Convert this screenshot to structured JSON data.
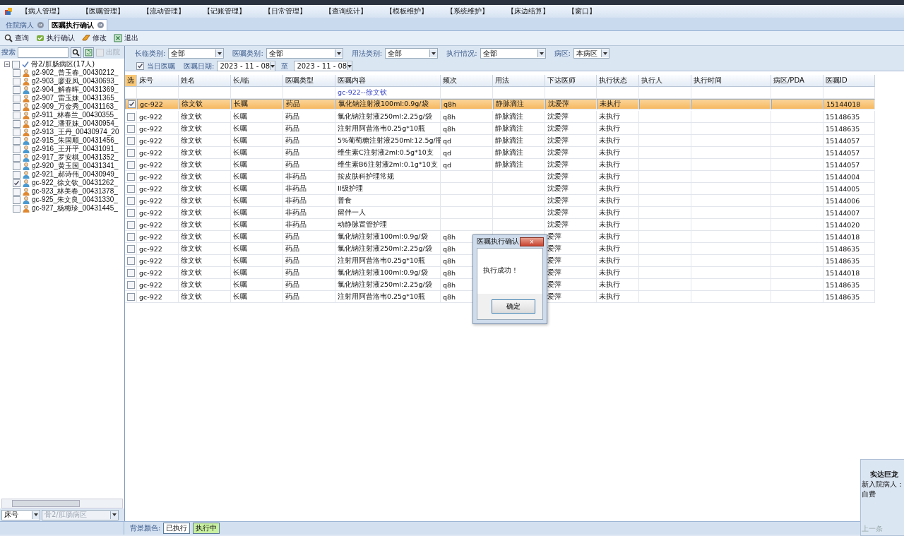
{
  "menu": [
    "【病人管理】",
    "【医嘱管理】",
    "【流动管理】",
    "【记账管理】",
    "【日常管理】",
    "【查询统计】",
    "【模板维护】",
    "【系统维护】",
    "【床边结算】",
    "【窗口】"
  ],
  "tabs": [
    {
      "label": "住院病人",
      "selected": false
    },
    {
      "label": "医嘱执行确认",
      "selected": true
    }
  ],
  "toolbar": [
    {
      "label": "查询",
      "kind": "search"
    },
    {
      "label": "执行确认",
      "kind": "confirm"
    },
    {
      "label": "修改",
      "kind": "edit"
    },
    {
      "label": "退出",
      "kind": "exit"
    }
  ],
  "sidebar": {
    "search_label": "搜索",
    "discharged": {
      "label": "出院",
      "checked": false,
      "disabled": true
    },
    "tree": {
      "label": "骨2/肛肠病区(17人)",
      "expanded": true,
      "checked": false,
      "children": [
        {
          "label": "g2-902_曾玉春_00430212_",
          "kind": "female",
          "checked": false
        },
        {
          "label": "g2-903_廖亚凤_00430693_",
          "kind": "female",
          "checked": false
        },
        {
          "label": "g2-904_解春晖_00431369_",
          "kind": "male",
          "checked": false
        },
        {
          "label": "g2-907_雷玉妹_00431365_",
          "kind": "female",
          "checked": false
        },
        {
          "label": "g2-909_万金秀_00431163_",
          "kind": "female",
          "checked": false
        },
        {
          "label": "g2-911_林春兰_00430355_",
          "kind": "female",
          "checked": false
        },
        {
          "label": "g2-912_潘亚妹_00430954_",
          "kind": "female",
          "checked": false
        },
        {
          "label": "g2-913_王丹_00430974_20",
          "kind": "female",
          "checked": false
        },
        {
          "label": "g2-915_朱国顺_00431456_",
          "kind": "male",
          "checked": false
        },
        {
          "label": "g2-916_王开平_00431091_",
          "kind": "male",
          "checked": false
        },
        {
          "label": "g2-917_罗安棋_00431352_",
          "kind": "male",
          "checked": false
        },
        {
          "label": "g2-920_黄玉国_00431341_",
          "kind": "male",
          "checked": false
        },
        {
          "label": "g2-921_郝诗伟_00430949_",
          "kind": "male",
          "checked": false
        },
        {
          "label": "gc-922_徐文钦_00431262_",
          "kind": "male",
          "checked": true
        },
        {
          "label": "gc-923_林美春_00431378_",
          "kind": "female",
          "checked": false
        },
        {
          "label": "gc-925_朱文良_00431330_",
          "kind": "male",
          "checked": false
        },
        {
          "label": "gc-927_杨梅珍_00431445_",
          "kind": "female",
          "checked": false
        }
      ]
    },
    "sort_select": "床号",
    "ward_select": {
      "value": "骨2/肛肠病区",
      "disabled": true
    }
  },
  "filters": [
    {
      "label": "长临类别:",
      "value": "全部"
    },
    {
      "label": "医嘱类别:",
      "value": "全部"
    },
    {
      "label": "用法类别:",
      "value": "全部"
    },
    {
      "label": "执行情况:",
      "value": "全部"
    },
    {
      "label": "病区:",
      "value": "本病区"
    }
  ],
  "today_only": {
    "label": "当日医嘱",
    "checked": true
  },
  "date_range": {
    "label": "医嘱日期:",
    "from": "2023 - 11 - 08",
    "separator": "至",
    "to": "2023 - 11 - 08"
  },
  "table": {
    "columns": [
      "选",
      "床号",
      "姓名",
      "长/临",
      "医嘱类型",
      "医嘱内容",
      "频次",
      "用法",
      "下达医师",
      "执行状态",
      "执行人",
      "执行时间",
      "病区/PDA",
      "医嘱ID"
    ],
    "group_label": "gc-922--徐文钦",
    "rows": [
      {
        "bed": "gc-922",
        "name": "徐文钦",
        "term": "长嘱",
        "type": "药品",
        "content": "氯化钠注射液100ml:0.9g/袋",
        "freq": "q8h",
        "usage": "静脉滴注",
        "doctor": "沈爱萍",
        "status": "未执行",
        "order_id": "15144018",
        "checked": true,
        "selected": true
      },
      {
        "bed": "gc-922",
        "name": "徐文钦",
        "term": "长嘱",
        "type": "药品",
        "content": "氯化钠注射液250ml:2.25g/袋",
        "freq": "q8h",
        "usage": "静脉滴注",
        "doctor": "沈爱萍",
        "status": "未执行",
        "order_id": "15148635",
        "checked": false,
        "selected": false
      },
      {
        "bed": "gc-922",
        "name": "徐文钦",
        "term": "长嘱",
        "type": "药品",
        "content": "注射用阿昔洛韦0.25g*10瓶",
        "freq": "q8h",
        "usage": "静脉滴注",
        "doctor": "沈爱萍",
        "status": "未执行",
        "order_id": "15148635",
        "checked": false,
        "selected": false
      },
      {
        "bed": "gc-922",
        "name": "徐文钦",
        "term": "长嘱",
        "type": "药品",
        "content": "5%葡萄糖注射液250ml:12.5g/瓶",
        "freq": "qd",
        "usage": "静脉滴注",
        "doctor": "沈爱萍",
        "status": "未执行",
        "order_id": "15144057",
        "checked": false,
        "selected": false
      },
      {
        "bed": "gc-922",
        "name": "徐文钦",
        "term": "长嘱",
        "type": "药品",
        "content": "维生素C注射液2ml:0.5g*10支",
        "freq": "qd",
        "usage": "静脉滴注",
        "doctor": "沈爱萍",
        "status": "未执行",
        "order_id": "15144057",
        "checked": false,
        "selected": false
      },
      {
        "bed": "gc-922",
        "name": "徐文钦",
        "term": "长嘱",
        "type": "药品",
        "content": "维生素B6注射液2ml:0.1g*10支",
        "freq": "qd",
        "usage": "静脉滴注",
        "doctor": "沈爱萍",
        "status": "未执行",
        "order_id": "15144057",
        "checked": false,
        "selected": false
      },
      {
        "bed": "gc-922",
        "name": "徐文钦",
        "term": "长嘱",
        "type": "非药品",
        "content": "按皮肤科护理常规",
        "doctor": "沈爱萍",
        "status": "未执行",
        "order_id": "15144004",
        "checked": false,
        "selected": false
      },
      {
        "bed": "gc-922",
        "name": "徐文钦",
        "term": "长嘱",
        "type": "非药品",
        "content": "II级护理",
        "doctor": "沈爱萍",
        "status": "未执行",
        "order_id": "15144005",
        "checked": false,
        "selected": false
      },
      {
        "bed": "gc-922",
        "name": "徐文钦",
        "term": "长嘱",
        "type": "非药品",
        "content": "普食",
        "doctor": "沈爱萍",
        "status": "未执行",
        "order_id": "15144006",
        "checked": false,
        "selected": false
      },
      {
        "bed": "gc-922",
        "name": "徐文钦",
        "term": "长嘱",
        "type": "非药品",
        "content": "留伴一人",
        "doctor": "沈爱萍",
        "status": "未执行",
        "order_id": "15144007",
        "checked": false,
        "selected": false
      },
      {
        "bed": "gc-922",
        "name": "徐文钦",
        "term": "长嘱",
        "type": "非药品",
        "content": "动静脉置管护理",
        "doctor": "沈爱萍",
        "status": "未执行",
        "order_id": "15144020",
        "checked": false,
        "selected": false
      },
      {
        "bed": "gc-922",
        "name": "徐文钦",
        "term": "长嘱",
        "type": "药品",
        "content": "氯化钠注射液100ml:0.9g/袋",
        "freq": "q8h",
        "doctor": "爱萍",
        "status": "未执行",
        "order_id": "15144018",
        "checked": false,
        "selected": false
      },
      {
        "bed": "gc-922",
        "name": "徐文钦",
        "term": "长嘱",
        "type": "药品",
        "content": "氯化钠注射液250ml:2.25g/袋",
        "freq": "q8h",
        "doctor": "爱萍",
        "status": "未执行",
        "order_id": "15148635",
        "checked": false,
        "selected": false
      },
      {
        "bed": "gc-922",
        "name": "徐文钦",
        "term": "长嘱",
        "type": "药品",
        "content": "注射用阿昔洛韦0.25g*10瓶",
        "freq": "q8h",
        "doctor": "爱萍",
        "status": "未执行",
        "order_id": "15148635",
        "checked": false,
        "selected": false
      },
      {
        "bed": "gc-922",
        "name": "徐文钦",
        "term": "长嘱",
        "type": "药品",
        "content": "氯化钠注射液100ml:0.9g/袋",
        "freq": "q8h",
        "doctor": "爱萍",
        "status": "未执行",
        "order_id": "15144018",
        "checked": false,
        "selected": false
      },
      {
        "bed": "gc-922",
        "name": "徐文钦",
        "term": "长嘱",
        "type": "药品",
        "content": "氯化钠注射液250ml:2.25g/袋",
        "freq": "q8h",
        "doctor": "爱萍",
        "status": "未执行",
        "order_id": "15148635",
        "checked": false,
        "selected": false
      },
      {
        "bed": "gc-922",
        "name": "徐文钦",
        "term": "长嘱",
        "type": "药品",
        "content": "注射用阿昔洛韦0.25g*10瓶",
        "freq": "q8h",
        "doctor": "爱萍",
        "status": "未执行",
        "order_id": "15148635",
        "checked": false,
        "selected": false
      }
    ]
  },
  "status_bar": {
    "label": "背景颜色:",
    "legend": [
      {
        "label": "已执行",
        "color": "#ffffff"
      },
      {
        "label": "执行中",
        "color": "#c8f0a0"
      }
    ]
  },
  "dialog": {
    "title": "医嘱执行确认",
    "close": "×",
    "message": "执行成功！",
    "button": "确定"
  },
  "notification": {
    "title": "实达巨龙",
    "lines": [
      "新入院病人：",
      "自费"
    ],
    "button": "上一条"
  }
}
